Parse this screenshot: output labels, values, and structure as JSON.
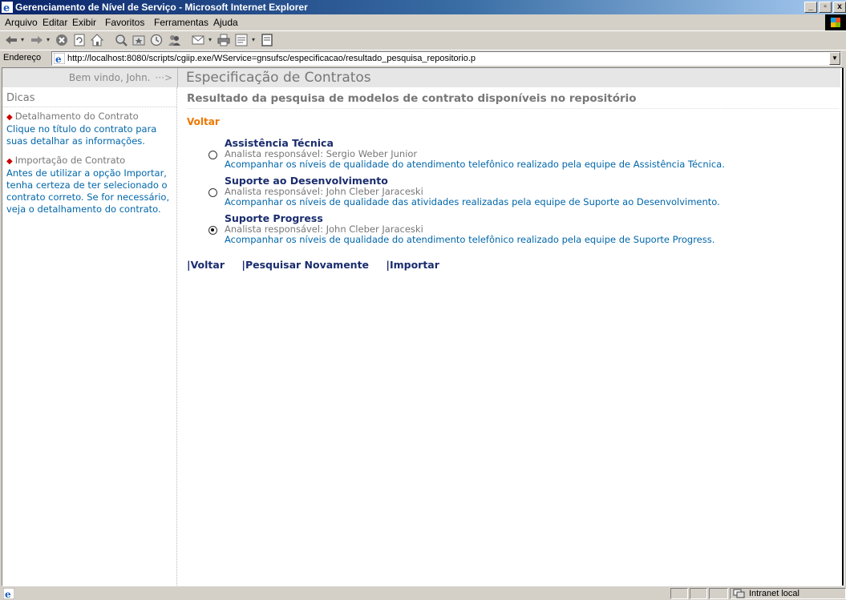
{
  "window": {
    "title": "Gerenciamento de Nível de Serviço - Microsoft Internet Explorer",
    "ctrl_min": "_",
    "ctrl_max": "▫",
    "ctrl_close": "x"
  },
  "menu": [
    "Arquivo",
    "Editar",
    "Exibir",
    "Favoritos",
    "Ferramentas",
    "Ajuda"
  ],
  "toolbar_icons": [
    "back-arrow-icon",
    "forward-arrow-icon",
    "stop-icon",
    "refresh-icon",
    "home-icon",
    "search-icon",
    "favorites-icon",
    "history-icon",
    "messenger-icon",
    "mail-icon",
    "print-icon",
    "edit-icon",
    "discuss-icon"
  ],
  "address": {
    "label": "Endereço",
    "url": "http://localhost:8080/scripts/cgiip.exe/WService=gnsufsc/especificacao/resultado_pesquisa_repositorio.p"
  },
  "header": {
    "welcome": "Bem vindo, John.",
    "welcome_arrow": "···>",
    "page_title": "Especificação de Contratos"
  },
  "sidebar": {
    "title": "Dicas",
    "tips": [
      {
        "heading": "Detalhamento do Contrato",
        "body": "Clique no título do contrato para suas detalhar as informações."
      },
      {
        "heading": "Importação de Contrato",
        "body": "Antes de utilizar a opção Importar, tenha certeza de ter selecionado o contrato correto. Se for necessário, veja o detalhamento do contrato."
      }
    ]
  },
  "main": {
    "subtitle": "Resultado da pesquisa de modelos de contrato disponíveis no repositório",
    "voltar_top": "Voltar",
    "contracts": [
      {
        "name": "Assistência Técnica",
        "analyst": "Analista responsável: Sergio Weber Junior",
        "description": "Acompanhar os níveis de qualidade do atendimento telefônico realizado pela equipe de Assistência Técnica.",
        "selected": false
      },
      {
        "name": "Suporte ao Desenvolvimento",
        "analyst": "Analista responsável: John Cleber Jaraceski",
        "description": "Acompanhar os níveis de qualidade das atividades realizadas pela equipe de Suporte ao Desenvolvimento.",
        "selected": false
      },
      {
        "name": "Suporte Progress",
        "analyst": "Analista responsável: John Cleber Jaraceski",
        "description": "Acompanhar os níveis de qualidade do atendimento telefônico realizado pela equipe de Suporte Progress.",
        "selected": true
      }
    ],
    "actions": [
      "|Voltar",
      "|Pesquisar Novamente",
      "|Importar"
    ]
  },
  "status": {
    "zone": "Intranet local"
  }
}
